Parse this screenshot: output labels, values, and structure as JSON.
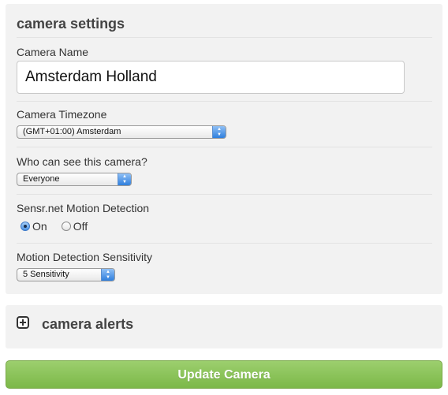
{
  "settings": {
    "title": "camera settings",
    "camera_name": {
      "label": "Camera Name",
      "value": "Amsterdam Holland"
    },
    "timezone": {
      "label": "Camera Timezone",
      "selected": "(GMT+01:00) Amsterdam"
    },
    "visibility": {
      "label": "Who can see this camera?",
      "selected": "Everyone"
    },
    "motion_detection": {
      "label": "Sensr.net Motion Detection",
      "options": [
        {
          "label": "On",
          "checked": true
        },
        {
          "label": "Off",
          "checked": false
        }
      ]
    },
    "sensitivity": {
      "label": "Motion Detection Sensitivity",
      "selected": "5 Sensitivity"
    }
  },
  "alerts": {
    "title": "camera alerts",
    "icon": "expand-plus-icon"
  },
  "actions": {
    "update_label": "Update Camera"
  },
  "colors": {
    "panel_bg": "#f2f2f2",
    "button_green": "#8cc45c",
    "select_arrow_blue": "#3d85de"
  }
}
